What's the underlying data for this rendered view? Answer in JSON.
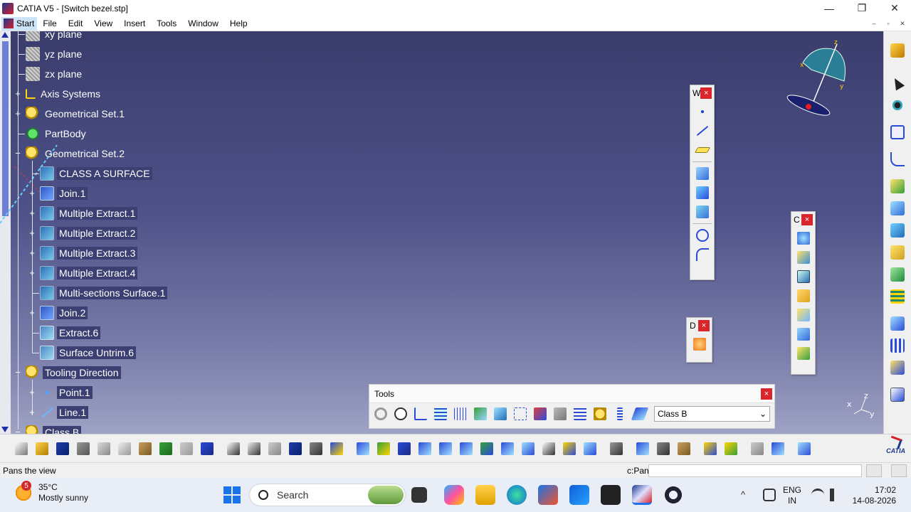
{
  "window": {
    "title": "CATIA V5 - [Switch bezel.stp]",
    "controls": {
      "minimize": "—",
      "maximize": "❐",
      "close": "✕"
    }
  },
  "menu": {
    "start": "Start",
    "items": [
      "File",
      "Edit",
      "View",
      "Insert",
      "Tools",
      "Window",
      "Help"
    ],
    "mdi_controls": {
      "minimize": "‒",
      "restore": "▫",
      "close": "✕"
    }
  },
  "tree": {
    "nodes": [
      {
        "label": "xy plane",
        "icon": "plane-icon",
        "level": 1,
        "expander": "none",
        "selected": false
      },
      {
        "label": "yz plane",
        "icon": "plane-icon",
        "level": 1,
        "expander": "none",
        "selected": false
      },
      {
        "label": "zx plane",
        "icon": "plane-icon",
        "level": 1,
        "expander": "none",
        "selected": false
      },
      {
        "label": "Axis Systems",
        "icon": "axis-system-icon",
        "level": 1,
        "expander": "+",
        "selected": false
      },
      {
        "label": "Geometrical Set.1",
        "icon": "geometrical-set-icon",
        "level": 1,
        "expander": "+",
        "selected": false
      },
      {
        "label": "PartBody",
        "icon": "partbody-icon",
        "level": 1,
        "expander": "none",
        "selected": false
      },
      {
        "label": "Geometrical Set.2",
        "icon": "geometrical-set-icon",
        "level": 1,
        "expander": "−",
        "selected": false
      },
      {
        "label": "CLASS A SURFACE",
        "icon": "surface-icon",
        "level": 2,
        "expander": "none",
        "selected": true
      },
      {
        "label": "Join.1",
        "icon": "join-icon",
        "level": 2,
        "expander": "+",
        "selected": true
      },
      {
        "label": "Multiple Extract.1",
        "icon": "multiple-extract-icon",
        "level": 2,
        "expander": "+",
        "selected": true
      },
      {
        "label": "Multiple Extract.2",
        "icon": "multiple-extract-icon",
        "level": 2,
        "expander": "+",
        "selected": true
      },
      {
        "label": "Multiple Extract.3",
        "icon": "multiple-extract-icon",
        "level": 2,
        "expander": "+",
        "selected": true
      },
      {
        "label": "Multiple Extract.4",
        "icon": "multiple-extract-icon",
        "level": 2,
        "expander": "+",
        "selected": true
      },
      {
        "label": "Multi-sections Surface.1",
        "icon": "multi-sections-surface-icon",
        "level": 2,
        "expander": "none",
        "selected": true
      },
      {
        "label": "Join.2",
        "icon": "join-icon",
        "level": 2,
        "expander": "+",
        "selected": true
      },
      {
        "label": "Extract.6",
        "icon": "extract-icon",
        "level": 2,
        "expander": "none",
        "selected": true
      },
      {
        "label": "Surface Untrim.6",
        "icon": "surface-untrim-icon",
        "level": 2,
        "expander": "none",
        "selected": true
      },
      {
        "label": "Tooling Direction",
        "icon": "geometrical-set-icon",
        "level": 1,
        "expander": "−",
        "selected": true
      },
      {
        "label": "Point.1",
        "icon": "point-icon",
        "level": 2,
        "expander": "+",
        "selected": true
      },
      {
        "label": "Line.1",
        "icon": "line-icon",
        "level": 2,
        "expander": "+",
        "selected": true
      },
      {
        "label": "Class B",
        "icon": "geometrical-set-icon",
        "level": 1,
        "expander": "−",
        "selected": true
      }
    ]
  },
  "floating_toolbars": {
    "wireframe": {
      "title": "W",
      "close": "×"
    },
    "surfaces": {
      "title": "C",
      "close": "×"
    },
    "draft": {
      "title": "D",
      "close": "×"
    },
    "tools": {
      "title": "Tools",
      "close": "×",
      "combo_value": "Class B",
      "combo_arrow": "⌄"
    }
  },
  "compass": {
    "x": "x",
    "y": "y",
    "z": "z"
  },
  "axis_triad": {
    "x": "x",
    "y": "y",
    "z": "z"
  },
  "statusbar": {
    "message": "Pans the view",
    "command_label": "c:Pan",
    "command_value": ""
  },
  "taskbar": {
    "weather_temp": "35°C",
    "weather_desc": "Mostly sunny",
    "weather_badge": "5",
    "search_placeholder": "Search",
    "lang_line1": "ENG",
    "lang_line2": "IN",
    "time": "17:02",
    "date": "14-08-2026",
    "tray_chevron": "^"
  },
  "branding": {
    "logo_text": "CATIA"
  },
  "colors": {
    "viewport_top": "#3a3c6c",
    "viewport_bottom": "#9ea2c4",
    "selection": "#3c3f72",
    "close_red": "#d9262d",
    "windows_blue": "#1a73e8"
  }
}
